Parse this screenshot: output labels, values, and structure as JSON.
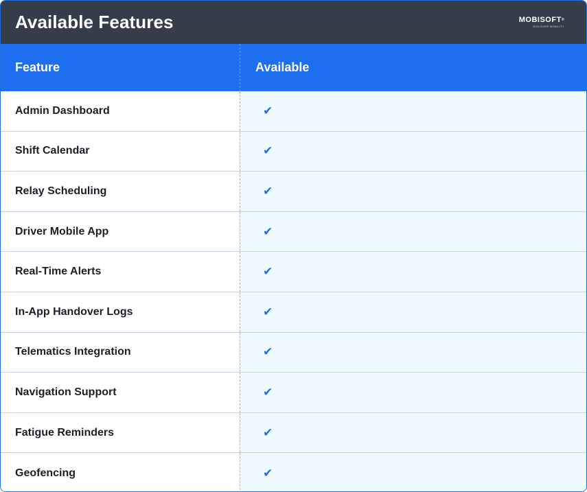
{
  "header": {
    "title": "Available Features",
    "logo_text": "MOBISOFT",
    "logo_tagline": "DISCOVER MOBILITY"
  },
  "table": {
    "columns": [
      "Feature",
      "Available"
    ],
    "rows": [
      {
        "feature": "Admin Dashboard",
        "available": "✔"
      },
      {
        "feature": "Shift Calendar",
        "available": "✔"
      },
      {
        "feature": "Relay Scheduling",
        "available": "✔"
      },
      {
        "feature": "Driver Mobile App",
        "available": "✔"
      },
      {
        "feature": "Real-Time Alerts",
        "available": "✔"
      },
      {
        "feature": "In-App Handover Logs",
        "available": "✔"
      },
      {
        "feature": "Telematics Integration",
        "available": "✔"
      },
      {
        "feature": "Navigation Support",
        "available": "✔"
      },
      {
        "feature": "Fatigue Reminders",
        "available": "✔"
      },
      {
        "feature": "Geofencing",
        "available": "✔"
      }
    ]
  },
  "colors": {
    "titlebar": "#353d4a",
    "header_row": "#1e6ff0",
    "available_cell": "#eefafe",
    "check": "#1d6fe0"
  }
}
